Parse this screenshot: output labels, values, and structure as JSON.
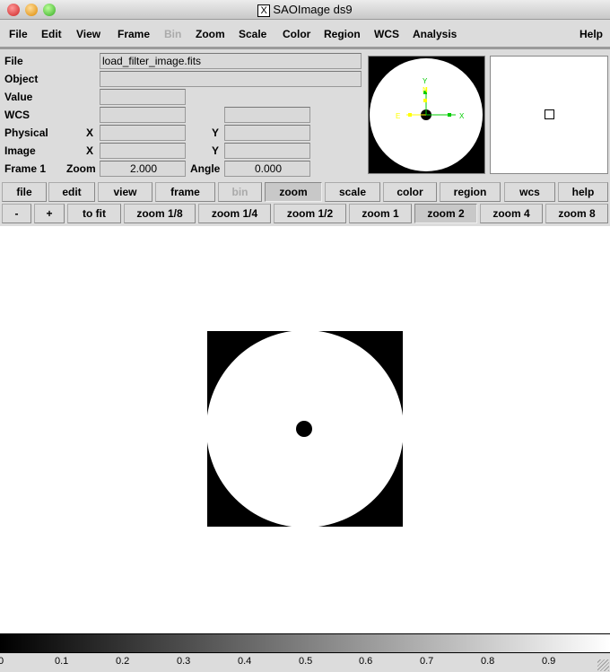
{
  "window": {
    "title": "SAOImage ds9",
    "x_icon": "X"
  },
  "menu": [
    "File",
    "Edit",
    "View",
    "Frame",
    "Bin",
    "Zoom",
    "Scale",
    "Color",
    "Region",
    "WCS",
    "Analysis",
    "Help"
  ],
  "info": {
    "file_label": "File",
    "file_value": "load_filter_image.fits",
    "object_label": "Object",
    "value_label": "Value",
    "wcs_label": "WCS",
    "physical_label": "Physical",
    "image_label": "Image",
    "x_label": "X",
    "y_label": "Y",
    "frame_label": "Frame 1",
    "zoom_label": "Zoom",
    "zoom_value": "2.000",
    "angle_label": "Angle",
    "angle_value": "0.000"
  },
  "panner": {
    "compass": {
      "y": "Y",
      "n": "N",
      "e": "E",
      "x": "X"
    }
  },
  "buttonbar": [
    "file",
    "edit",
    "view",
    "frame",
    "bin",
    "zoom",
    "scale",
    "color",
    "region",
    "wcs",
    "help"
  ],
  "zoombar": [
    "-",
    "+",
    "to fit",
    "zoom 1/8",
    "zoom 1/4",
    "zoom 1/2",
    "zoom 1",
    "zoom 2",
    "zoom 4",
    "zoom 8"
  ],
  "colorbar": {
    "ticks": [
      "0",
      "0.1",
      "0.2",
      "0.3",
      "0.4",
      "0.5",
      "0.6",
      "0.7",
      "0.8",
      "0.9"
    ],
    "colormap": "grey",
    "range": [
      0,
      1
    ]
  },
  "colors": {
    "compass_wcs": "#ffff00",
    "compass_image": "#00cc00"
  }
}
